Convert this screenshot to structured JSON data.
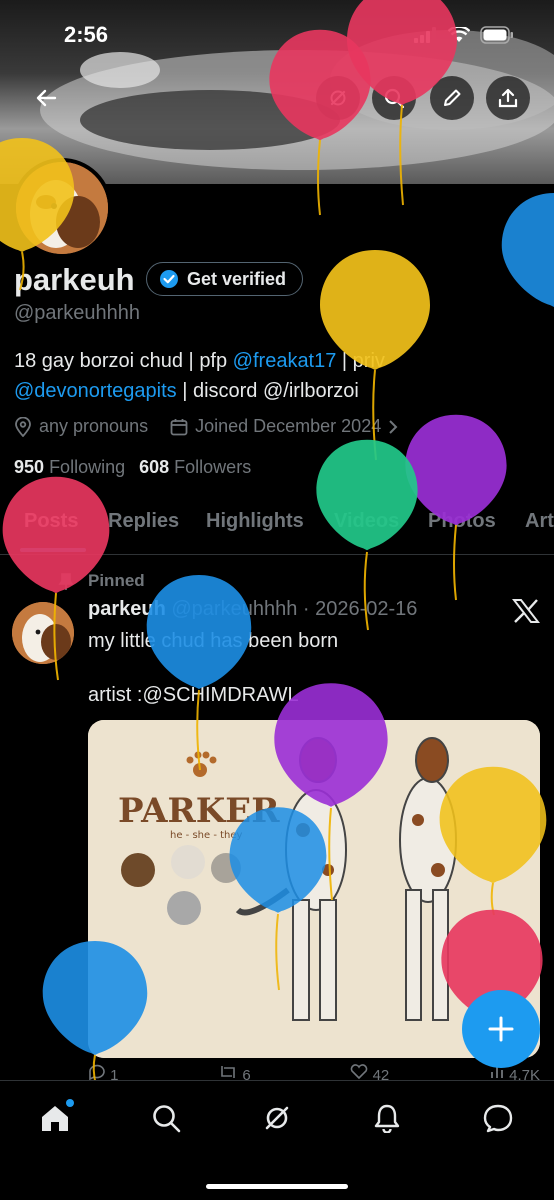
{
  "status_bar": {
    "time": "2:56"
  },
  "profile": {
    "display_name": "parkeuh",
    "verify_label": "Get verified",
    "handle": "@parkeuhhhh",
    "bio_line1_prefix": "18 gay borzoi chud | pfp ",
    "bio_mention1": "@freakat17",
    "bio_line1_suffix": " | priv",
    "bio_mention2": "@devonortegapits",
    "bio_line2_suffix": " | discord @/irlborzoi",
    "pronouns": "any pronouns",
    "joined": "Joined December 2024",
    "following_count": "950",
    "following_label": "Following",
    "followers_count": "608",
    "followers_label": "Followers"
  },
  "tabs": [
    "Posts",
    "Replies",
    "Highlights",
    "Videos",
    "Photos",
    "Art"
  ],
  "post": {
    "pinned_label": "Pinned",
    "author": "parkeuh",
    "handle_date": "@parkeuhhhh · 2026-02-16",
    "text": "my little chud has been born\n\nartist :@SCHIMDRAWL",
    "image_title": "PARKER",
    "image_subtitle": "he - she - they",
    "actions": [
      "1",
      "6",
      "42",
      "4.7K"
    ]
  },
  "colors": {
    "accent": "#1d9bf0",
    "background": "#000000",
    "text_primary": "#e7e9ea",
    "text_secondary": "#71767b",
    "balloon_colors": [
      "#e8375f",
      "#f2c21b",
      "#1d8fe6",
      "#9b2fd6",
      "#22c98a"
    ]
  },
  "icons": [
    "back-arrow-icon",
    "grok-icon",
    "search-icon",
    "edit-icon",
    "share-icon",
    "location-icon",
    "calendar-icon",
    "pin-icon",
    "x-logo-icon",
    "reply-icon",
    "repost-icon",
    "like-icon",
    "views-icon",
    "home-icon",
    "notifications-icon",
    "messages-icon",
    "compose-plus-icon"
  ]
}
